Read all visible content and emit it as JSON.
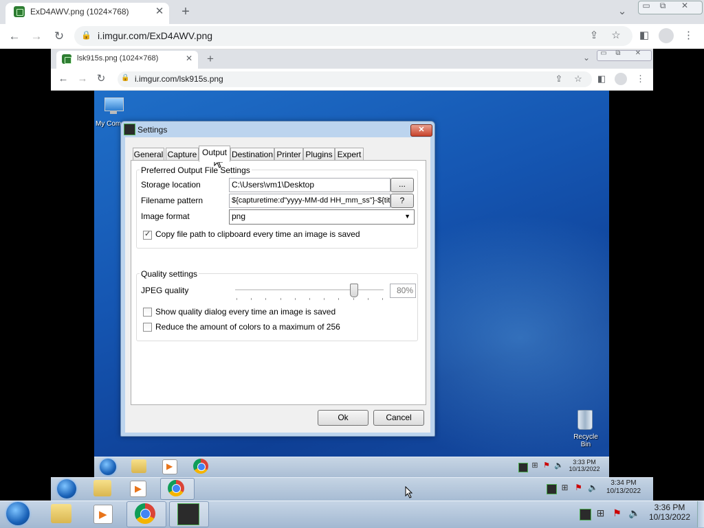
{
  "outer_browser": {
    "tab_title": "ExD4AWV.png (1024×768)",
    "url": "i.imgur.com/ExD4AWV.png"
  },
  "inner_browser": {
    "tab_title": "lsk915s.png (1024×768)",
    "url": "i.imgur.com/lsk915s.png"
  },
  "desktop": {
    "my_computer_label": "My Comp",
    "recycle_bin_label": "Recycle Bin"
  },
  "settings": {
    "title": "Settings",
    "tabs": [
      "General",
      "Capture",
      "Output",
      "Destination",
      "Printer",
      "Plugins",
      "Expert"
    ],
    "active_tab": "Output",
    "output_group_title": "Preferred Output File Settings",
    "storage_label": "Storage location",
    "storage_value": "C:\\Users\\vm1\\Desktop",
    "browse_button": "...",
    "filename_label": "Filename pattern",
    "filename_value": "${capturetime:d\"yyyy-MM-dd HH_mm_ss\"}-${title}",
    "help_button": "?",
    "format_label": "Image format",
    "format_value": "png",
    "copy_path_label": "Copy file path to clipboard every time an image is saved",
    "copy_path_checked": true,
    "quality_group_title": "Quality settings",
    "jpeg_label": "JPEG quality",
    "jpeg_value": "80%",
    "jpeg_level": 0.8,
    "quality_dialog_label": "Show quality dialog every time an image is saved",
    "quality_dialog_checked": false,
    "reduce_colors_label": "Reduce the amount of colors to a maximum of 256",
    "reduce_colors_checked": false,
    "ok_button": "Ok",
    "cancel_button": "Cancel"
  },
  "taskbars": {
    "inner_clock_time": "3:33 PM",
    "inner_clock_date": "10/13/2022",
    "middle_clock_time": "3:34 PM",
    "middle_clock_date": "10/13/2022",
    "outer_clock_time": "3:36 PM",
    "outer_clock_date": "10/13/2022"
  },
  "colors": {
    "desktop_blue": "#1556b2",
    "dialog_frame": "#bcd4ee",
    "close_red": "#c8442d"
  }
}
